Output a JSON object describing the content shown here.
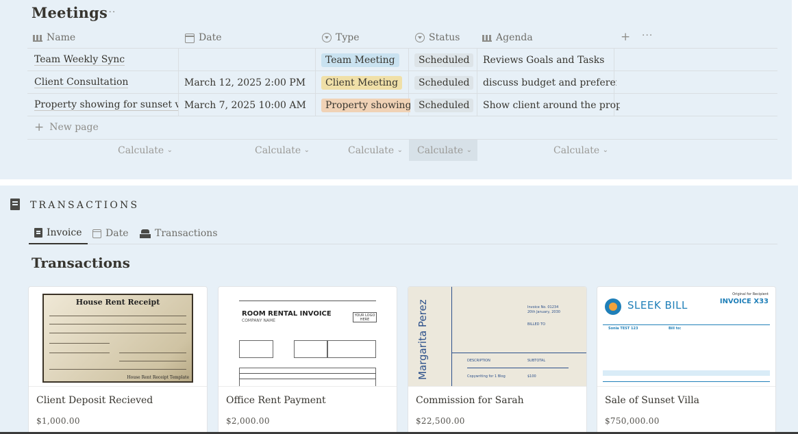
{
  "meetings": {
    "title": "Meetings",
    "more": "···",
    "columns": [
      {
        "label": "Name",
        "icon": "people-icon"
      },
      {
        "label": "Date",
        "icon": "calendar-icon"
      },
      {
        "label": "Type",
        "icon": "select-icon"
      },
      {
        "label": "Status",
        "icon": "status-icon"
      },
      {
        "label": "Agenda",
        "icon": "people-icon"
      }
    ],
    "add_column": "+",
    "more_column": "···",
    "rows": [
      {
        "name": "Team Weekly Sync",
        "date": "",
        "type": "Team Meeting",
        "type_color": "#c9e2f0",
        "status": "Scheduled",
        "agenda": "Reviews Goals and Tasks"
      },
      {
        "name": "Client Consultation",
        "date": "March 12, 2025 2:00 PM",
        "type": "Client Meeting",
        "type_color": "#f0e0a8",
        "status": "Scheduled",
        "agenda": "discuss budget and preferences"
      },
      {
        "name": "Property showing for sunset villa",
        "date": "March 7, 2025 10:00 AM",
        "type": "Property showing",
        "type_color": "#f0d2b6",
        "status": "Scheduled",
        "agenda": "Show client around the property"
      }
    ],
    "status_color": "#dde4e8",
    "new_page": "New page",
    "calculate": "Calculate"
  },
  "transactions": {
    "heading": "TRANSACTIONS",
    "views": [
      {
        "label": "Invoice",
        "icon": "receipt-icon"
      },
      {
        "label": "Date",
        "icon": "calendar-icon"
      },
      {
        "label": "Transactions",
        "icon": "bank-icon"
      }
    ],
    "title": "Transactions",
    "cards": [
      {
        "title": "Client Deposit Recieved",
        "amount": "$1,000.00",
        "cover": {
          "heading": "House Rent Receipt",
          "footer": "House Rent Receipt Template"
        }
      },
      {
        "title": "Office Rent Payment",
        "amount": "$2,000.00",
        "cover": {
          "heading": "ROOM RENTAL INVOICE",
          "sub": "COMPANY NAME",
          "logo": "YOUR LOGO HERE"
        }
      },
      {
        "title": "Commission for Sarah",
        "amount": "$22,500.00",
        "cover": {
          "name": "Margarita Perez",
          "invoice_no": "Invoice No. 01234",
          "date": "20th January, 2030",
          "billed_to": "BILLED TO",
          "desc": "DESCRIPTION",
          "subtotal": "SUBTOTAL",
          "item": "Copywriting for 1 Blog",
          "item_price": "$100"
        }
      },
      {
        "title": "Sale of Sunset Villa",
        "amount": "$750,000.00",
        "cover": {
          "brand": "SLEEK BILL",
          "invoice": "INVOICE X33",
          "recipient": "Original for Recipient",
          "sold_by": "Sonia TEST 123",
          "bill_to": "Bill to:"
        }
      }
    ]
  }
}
